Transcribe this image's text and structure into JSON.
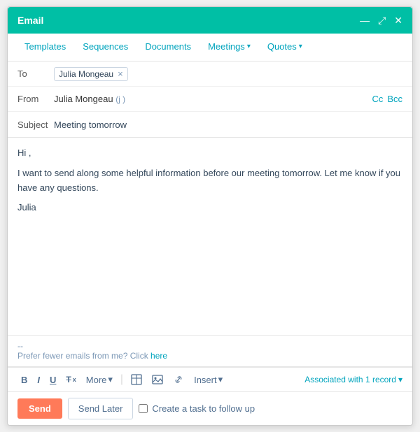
{
  "window": {
    "title": "Email",
    "controls": {
      "minimize": "—",
      "expand": "⤢",
      "close": "✕"
    }
  },
  "nav": {
    "items": [
      {
        "label": "Templates",
        "hasDropdown": false
      },
      {
        "label": "Sequences",
        "hasDropdown": false
      },
      {
        "label": "Documents",
        "hasDropdown": false
      },
      {
        "label": "Meetings",
        "hasDropdown": true
      },
      {
        "label": "Quotes",
        "hasDropdown": true
      }
    ]
  },
  "fields": {
    "to_label": "To",
    "to_value": "Julia Mongeau",
    "from_label": "From",
    "from_name": "Julia Mongeau",
    "from_email": "(j                          )",
    "cc_label": "Cc",
    "bcc_label": "Bcc",
    "subject_label": "Subject",
    "subject_value": "Meeting tomorrow"
  },
  "body": {
    "greeting": "Hi ,",
    "paragraph": "I want to send along some helpful information before our meeting tomorrow. Let me know if you have any questions.",
    "signature": "Julia",
    "divider": "--",
    "footer_text": "Prefer fewer emails from me? Click ",
    "footer_link": "here"
  },
  "toolbar": {
    "bold": "B",
    "italic": "I",
    "underline": "U",
    "strikethrough": "T",
    "more_label": "More",
    "more_chevron": "▾",
    "insert_label": "Insert",
    "insert_chevron": "▾",
    "associated_text": "Associated with 1 record",
    "associated_chevron": "▾"
  },
  "actions": {
    "send_label": "Send",
    "send_later_label": "Send Later",
    "task_label": "Create a task to follow up"
  }
}
